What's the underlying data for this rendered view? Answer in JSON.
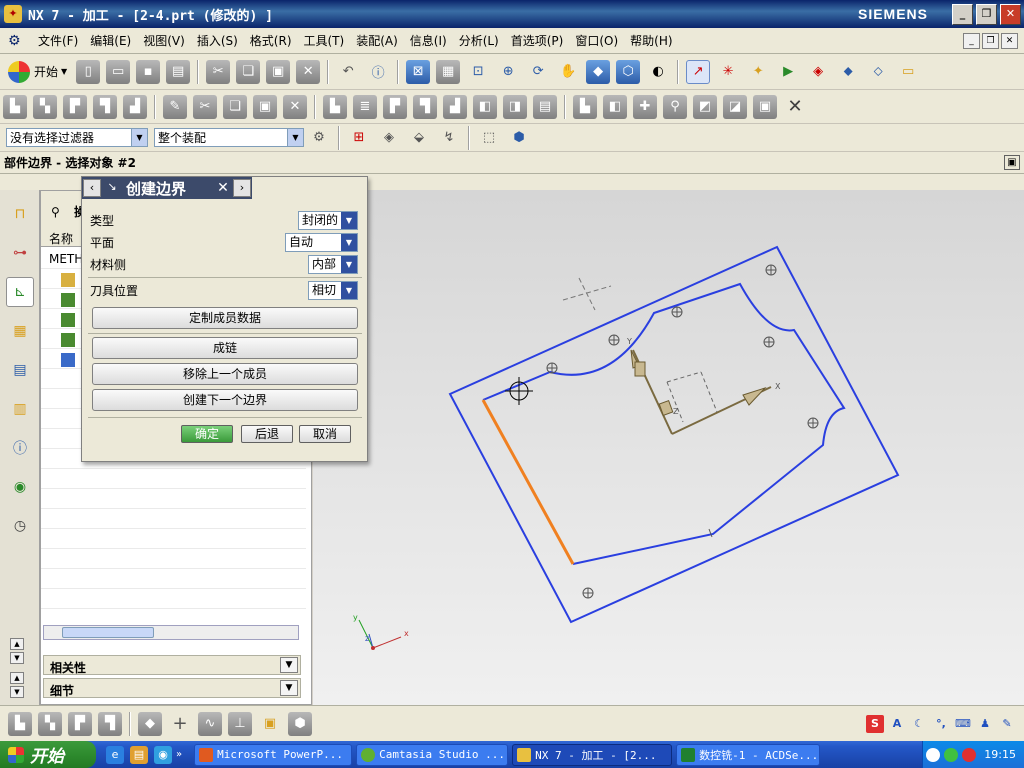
{
  "window": {
    "title": "NX 7 - 加工 - [2-4.prt  (修改的) ]",
    "brand": "SIEMENS"
  },
  "menubar": {
    "items": [
      "文件(F)",
      "编辑(E)",
      "视图(V)",
      "插入(S)",
      "格式(R)",
      "工具(T)",
      "装配(A)",
      "信息(I)",
      "分析(L)",
      "首选项(P)",
      "窗口(O)",
      "帮助(H)"
    ]
  },
  "toolbar": {
    "start_label": "开始"
  },
  "filters": {
    "selection_filter": "没有选择过滤器",
    "assembly_scope": "整个装配"
  },
  "status": {
    "prompt": "部件边界 - 选择对象 #2"
  },
  "navigator": {
    "header": "操",
    "column_name": "名称",
    "root_item": "METH"
  },
  "sections": {
    "dependencies": "相关性",
    "details": "细节"
  },
  "dialog": {
    "title": "创建边界",
    "type_label": "类型",
    "type_value": "封闭的",
    "plane_label": "平面",
    "plane_value": "自动",
    "material_side_label": "材料侧",
    "material_side_value": "内部",
    "tool_position_label": "刀具位置",
    "tool_position_value": "相切",
    "custom_member_data": "定制成员数据",
    "chain": "成链",
    "remove_last_member": "移除上一个成员",
    "create_next_boundary": "创建下一个边界",
    "ok": "确定",
    "back": "后退",
    "cancel": "取消"
  },
  "graphics": {
    "axis_x": "X",
    "axis_y": "Y",
    "axis_z": "Z",
    "triad_x": "x",
    "triad_y": "y",
    "triad_z": "z"
  },
  "taskbar": {
    "start": "开始",
    "tasks": [
      "Microsoft PowerP...",
      "Camtasia Studio ...",
      "NX 7 - 加工 - [2...",
      "数控铣-1 - ACDSe..."
    ],
    "clock": "19:15"
  },
  "colors": {
    "boundary_blue": "#2a3fe0",
    "selected_orange": "#f08020",
    "taskbar_blue": "#2458c8"
  }
}
